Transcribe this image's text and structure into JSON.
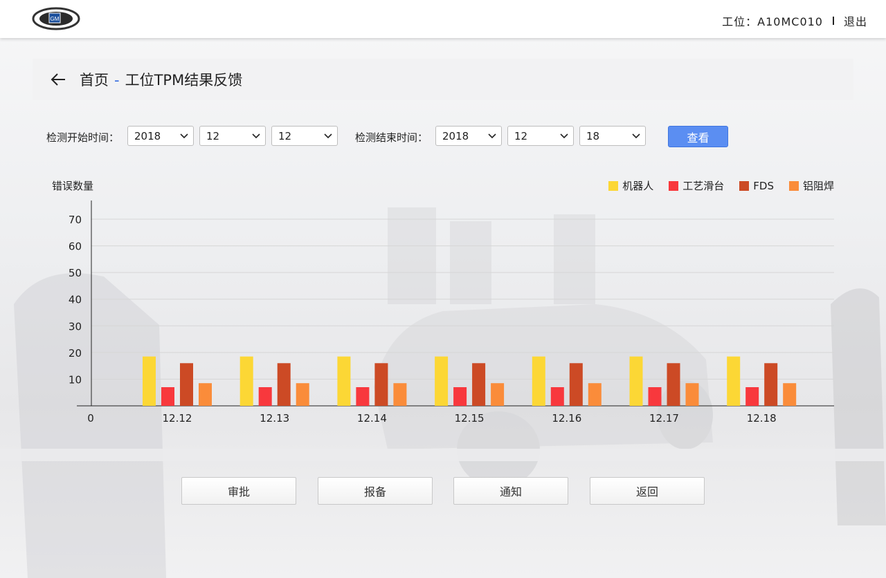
{
  "header": {
    "station_label": "工位：A10MC010",
    "logout_label": "退出",
    "logo_text": "GM"
  },
  "breadcrumb": {
    "home": "首页",
    "separator": "-",
    "current": "工位TPM结果反馈"
  },
  "filters": {
    "start_label": "检测开始时间：",
    "start_year": "2018",
    "start_month": "12",
    "start_day": "12",
    "end_label": "检测结束时间：",
    "end_year": "2018",
    "end_month": "12",
    "end_day": "18",
    "query_label": "查看"
  },
  "chart_data": {
    "type": "bar",
    "ylabel": "错误数量",
    "categories": [
      "12.12",
      "12.13",
      "12.14",
      "12.15",
      "12.16",
      "12.17",
      "12.18"
    ],
    "yticks": [
      0,
      10,
      20,
      30,
      40,
      50,
      60,
      70
    ],
    "ylim": [
      0,
      77
    ],
    "legend_position": "top-right",
    "grid": true,
    "series": [
      {
        "name": "机器人",
        "color": "#fcd735",
        "values": [
          18.5,
          18.5,
          18.5,
          18.5,
          18.5,
          18.5,
          18.5
        ]
      },
      {
        "name": "工艺滑台",
        "color": "#f8383d",
        "values": [
          7,
          7,
          7,
          7,
          7,
          7,
          7
        ]
      },
      {
        "name": "FDS",
        "color": "#cc4a25",
        "values": [
          16,
          16,
          16,
          16,
          16,
          16,
          16
        ]
      },
      {
        "name": "铝阻焊",
        "color": "#fa8c3a",
        "values": [
          8.5,
          8.5,
          8.5,
          8.5,
          8.5,
          8.5,
          8.5
        ]
      }
    ]
  },
  "actions": {
    "approve": "审批",
    "report": "报备",
    "notify": "通知",
    "back": "返回"
  }
}
